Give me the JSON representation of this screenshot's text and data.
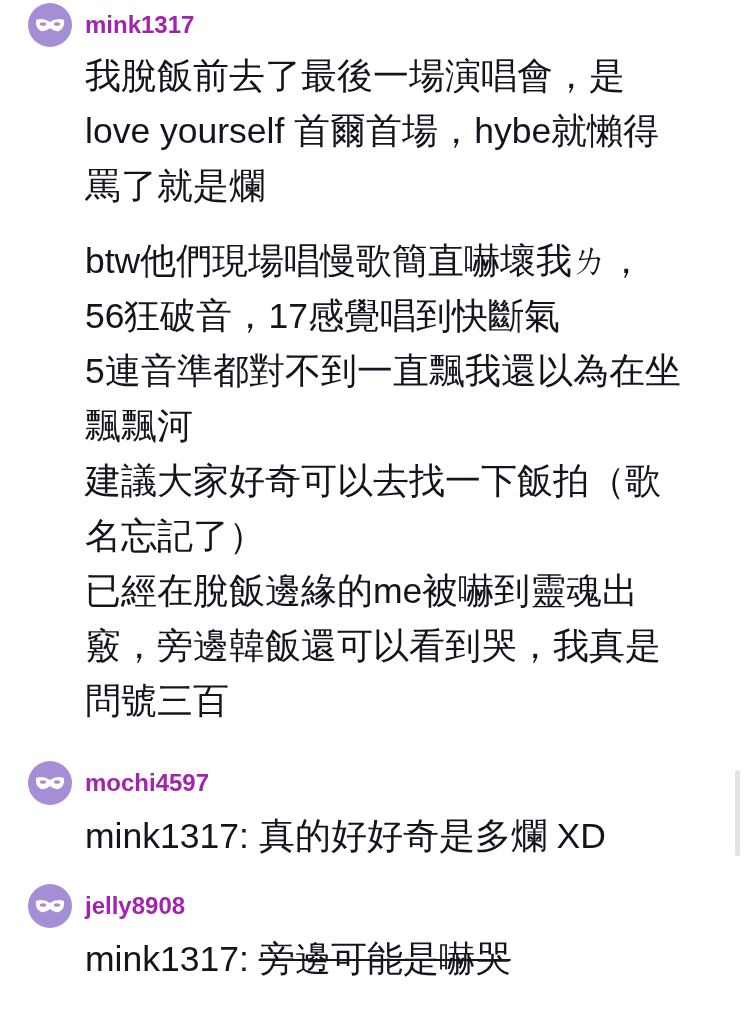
{
  "comments": [
    {
      "username": "mink1317",
      "paragraphs": [
        [
          "我脫飯前去了最後一場演唱會，是",
          "love yourself 首爾首場，hybe就懶得",
          "罵了就是爛"
        ],
        [
          "btw他們現場唱慢歌簡直嚇壞我ㄌ，",
          "56狂破音，17感覺唱到快斷氣",
          "5連音準都對不到一直飄我還以為在坐",
          "飄飄河",
          "建議大家好奇可以去找一下飯拍（歌",
          "名忘記了）",
          "已經在脫飯邊緣的me被嚇到靈魂出",
          "竅，旁邊韓飯還可以看到哭，我真是",
          "問號三百"
        ]
      ]
    },
    {
      "username": "mochi4597",
      "mention": "mink1317:",
      "text": "真的好好奇是多爛 XD",
      "struck": false
    },
    {
      "username": "jelly8908",
      "mention": "mink1317:",
      "text": "旁邊可能是嚇哭",
      "struck": true
    }
  ]
}
